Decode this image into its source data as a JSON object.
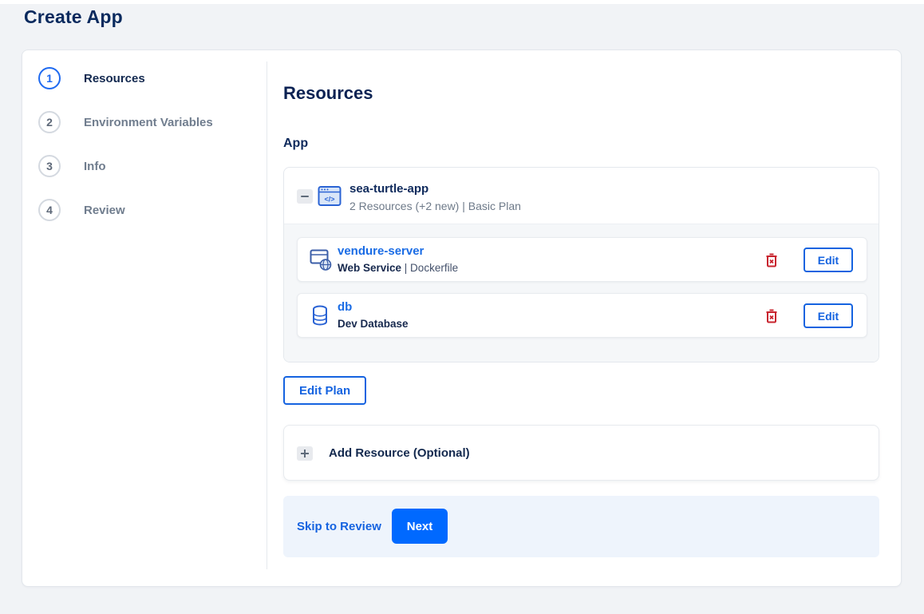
{
  "page": {
    "title": "Create App"
  },
  "stepper": {
    "steps": [
      {
        "number": "1",
        "label": "Resources",
        "active": true
      },
      {
        "number": "2",
        "label": "Environment Variables",
        "active": false
      },
      {
        "number": "3",
        "label": "Info",
        "active": false
      },
      {
        "number": "4",
        "label": "Review",
        "active": false
      }
    ]
  },
  "content": {
    "heading": "Resources",
    "section_label": "App",
    "app_group": {
      "name": "sea-turtle-app",
      "summary": "2 Resources (+2 new) | Basic Plan",
      "resources": [
        {
          "name": "vendure-server",
          "type_bold": "Web Service",
          "type_rest": " | Dockerfile",
          "icon": "web-service-icon",
          "edit_label": "Edit"
        },
        {
          "name": "db",
          "type_bold": "Dev Database",
          "type_rest": "",
          "icon": "database-icon",
          "edit_label": "Edit"
        }
      ]
    },
    "edit_plan_label": "Edit Plan",
    "add_resource_label": "Add Resource (Optional)",
    "footer": {
      "skip_label": "Skip to Review",
      "next_label": "Next"
    }
  },
  "colors": {
    "primary_blue": "#0069ff",
    "link_blue": "#1563e0",
    "navy_text": "#0b2253",
    "muted_text": "#6e7a89",
    "danger_red": "#c8242e",
    "page_background": "#f1f3f6",
    "panel_background": "#f5f7f9",
    "footer_background": "#eef4fc"
  }
}
